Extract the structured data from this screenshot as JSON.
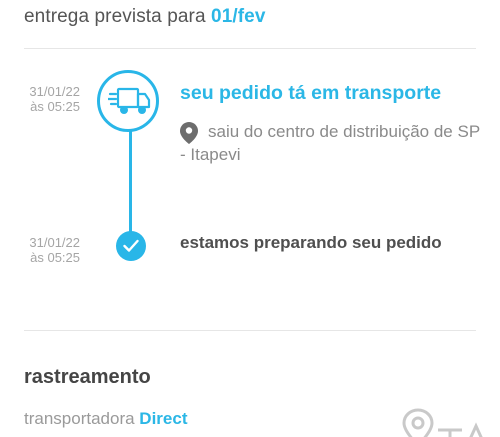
{
  "header": {
    "delivery_prefix": "entrega prevista para ",
    "delivery_date": "01/fev"
  },
  "timeline": {
    "events": [
      {
        "date": "31/01/22",
        "time": "às 05:25",
        "title": "seu pedido tá em transporte",
        "location": "saiu do centro de distribuição de SP - Itapevi",
        "icon": "truck-icon"
      },
      {
        "date": "31/01/22",
        "time": "às 05:25",
        "title": "estamos preparando seu pedido",
        "icon": "check-icon"
      }
    ]
  },
  "tracking": {
    "title": "rastreamento",
    "carrier_label": "transportadora ",
    "carrier_name": "Direct"
  },
  "colors": {
    "accent": "#2bb7e6",
    "line": "#29b6e8"
  }
}
